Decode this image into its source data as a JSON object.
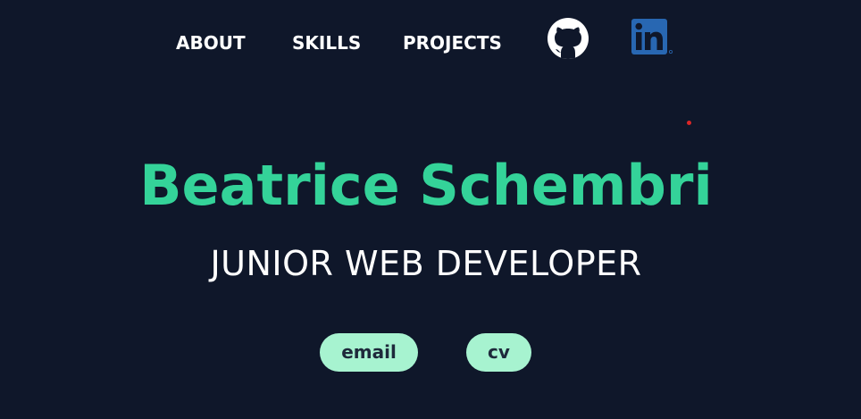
{
  "nav": {
    "about": "ABOUT",
    "skills": "SKILLS",
    "projects": "PROJECTS",
    "github_icon": "github-icon",
    "linkedin_icon": "linkedin-icon"
  },
  "hero": {
    "name": "Beatrice Schembri",
    "role": "JUNIOR WEB DEVELOPER"
  },
  "actions": {
    "email_label": "email",
    "cv_label": "cv"
  },
  "colors": {
    "background": "#0f172a",
    "accent": "#34d399",
    "pill": "#a7f3d0",
    "linkedin": "#2867b2"
  }
}
